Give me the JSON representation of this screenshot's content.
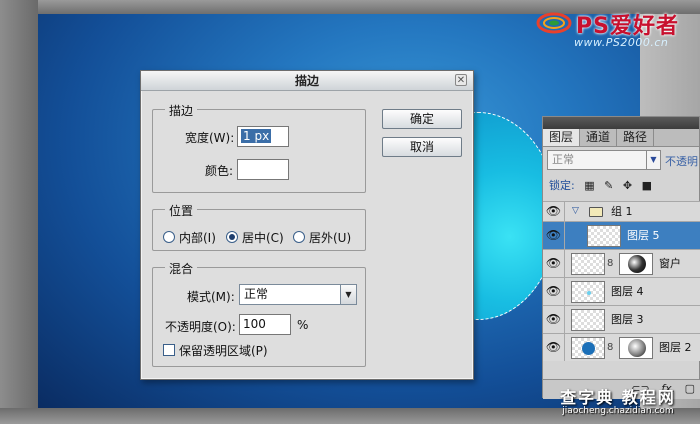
{
  "watermark": {
    "brand": "PS爱好者",
    "url": "www.PS2000.cn",
    "bottom_title": "查字典 教程网",
    "bottom_url": "jiaocheng.chazidian.com"
  },
  "dialog": {
    "title": "描边",
    "close_icon": "close-icon",
    "stroke_section": {
      "legend": "描边",
      "width_label": "宽度(W):",
      "width_value": "1 px",
      "color_label": "颜色:",
      "color_value": "#ffffff"
    },
    "position_section": {
      "legend": "位置",
      "options": [
        "内部(I)",
        "居中(C)",
        "居外(U)"
      ],
      "selected": "居中(C)"
    },
    "blend_section": {
      "legend": "混合",
      "mode_label": "模式(M):",
      "mode_value": "正常",
      "opacity_label": "不透明度(O):",
      "opacity_value": "100",
      "opacity_unit": "%",
      "preserve_label": "保留透明区域(P)",
      "preserve_checked": false
    },
    "ok_label": "确定",
    "cancel_label": "取消"
  },
  "layers_panel": {
    "tabs": [
      "图层",
      "通道",
      "路径"
    ],
    "active_tab": "图层",
    "blend_mode": "正常",
    "opacity_label": "不透明",
    "lock_label": "锁定:",
    "layers": [
      {
        "name": "组 1",
        "type": "group"
      },
      {
        "name": "图层 5",
        "type": "layer",
        "selected": true
      },
      {
        "name": "窗户",
        "type": "layer-mask"
      },
      {
        "name": "图层 4",
        "type": "layer"
      },
      {
        "name": "图层 3",
        "type": "layer"
      },
      {
        "name": "图层 2",
        "type": "layer-mask"
      }
    ],
    "bottom_fx": "fx."
  },
  "colors": {
    "canvas_blue": "#2477c0",
    "circle_cyan": "#18bde2",
    "selected_layer": "#3d7fc0"
  }
}
